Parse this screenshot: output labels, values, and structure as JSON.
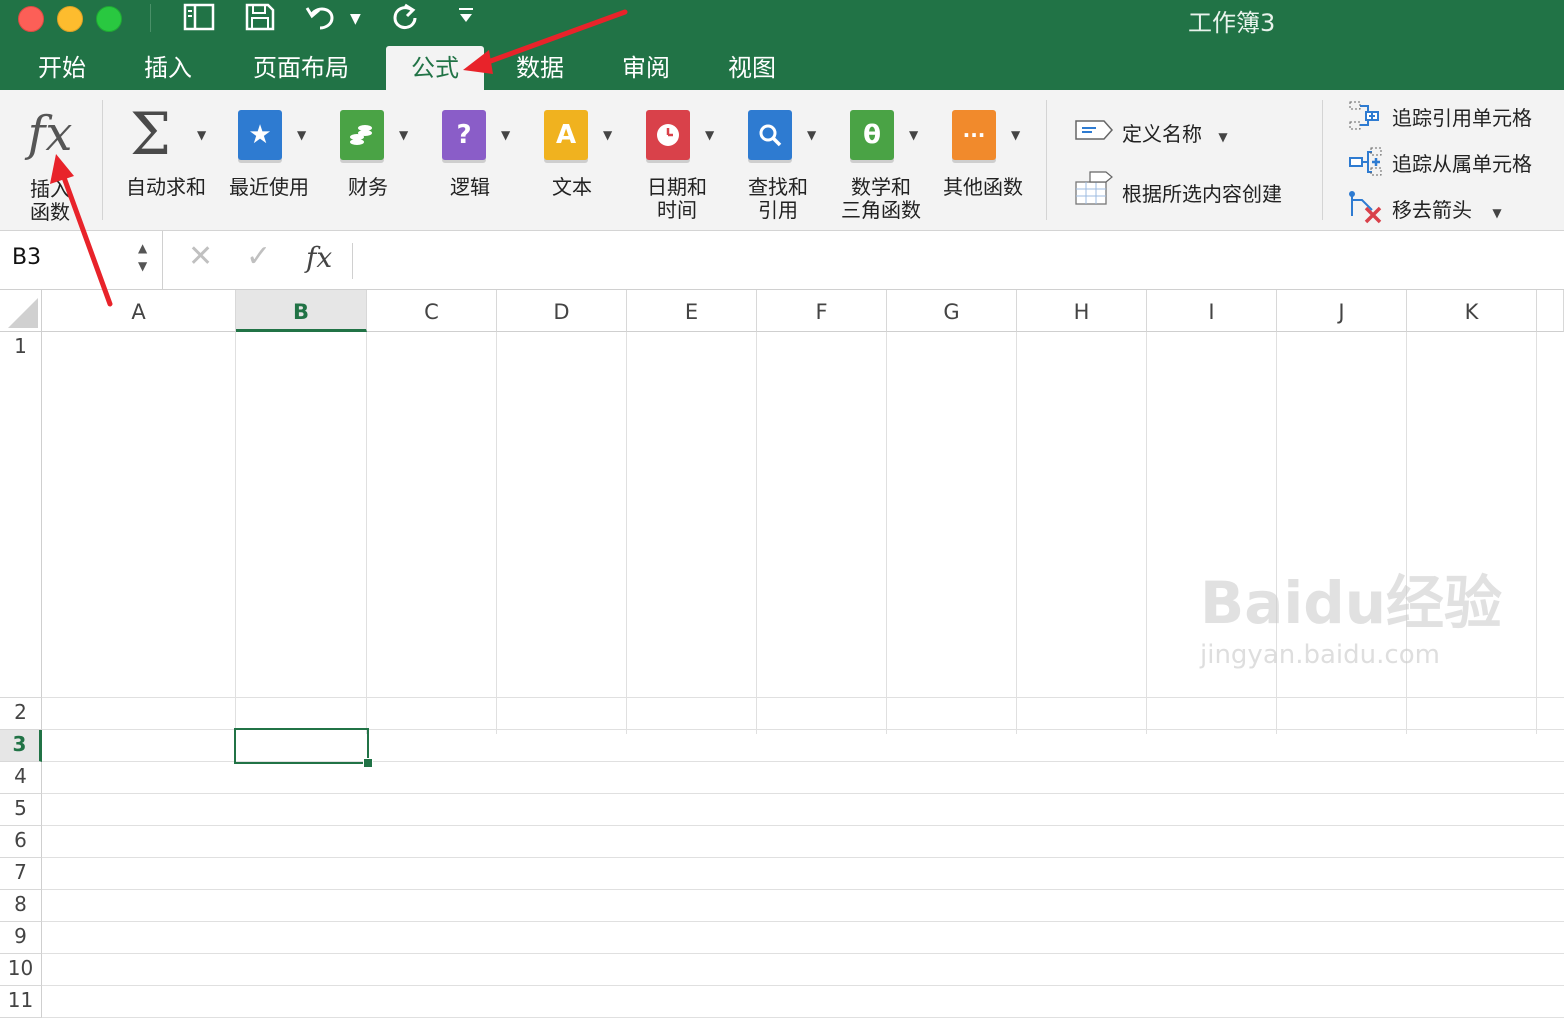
{
  "window": {
    "title": "工作簿3"
  },
  "toolbar_icons": [
    "sidebar-icon",
    "save-icon",
    "undo-icon",
    "redo-icon",
    "customize-icon"
  ],
  "tabs": [
    {
      "label": "开始"
    },
    {
      "label": "插入"
    },
    {
      "label": "页面布局"
    },
    {
      "label": "公式"
    },
    {
      "label": "数据"
    },
    {
      "label": "审阅"
    },
    {
      "label": "视图"
    }
  ],
  "active_tab": "公式",
  "ribbon": {
    "insert_function": {
      "line1": "插入",
      "line2": "函数",
      "icon": "fx"
    },
    "autosum": {
      "label": "自动求和",
      "icon": "Σ"
    },
    "recent": {
      "label": "最近使用",
      "icon": "★"
    },
    "finance": {
      "label": "财务"
    },
    "logic": {
      "label": "逻辑",
      "icon": "?"
    },
    "text": {
      "label": "文本",
      "icon": "A"
    },
    "datetime": {
      "line1": "日期和",
      "line2": "时间"
    },
    "lookup": {
      "line1": "查找和",
      "line2": "引用"
    },
    "math": {
      "line1": "数学和",
      "line2": "三角函数",
      "icon": "θ"
    },
    "other": {
      "label": "其他函数",
      "icon": "···"
    },
    "define_name": "定义名称",
    "create_from_selection": "根据所选内容创建",
    "trace_precedents": "追踪引用单元格",
    "trace_dependents": "追踪从属单元格",
    "remove_arrows": "移去箭头"
  },
  "colors": {
    "brand": "#217346",
    "autosum": "#4a4a4a",
    "recent": "#2e7bd1",
    "finance": "#4aa345",
    "logic": "#8a5dc8",
    "text": "#f0b21f",
    "datetime": "#d9414a",
    "lookup": "#2e7bd1",
    "math": "#4aa345",
    "other": "#f18a2c",
    "annotation_arrow": "#e8232a"
  },
  "formula_bar": {
    "name_box": "B3",
    "fx": "fx",
    "value": ""
  },
  "columns": [
    "A",
    "B",
    "C",
    "D",
    "E",
    "F",
    "G",
    "H",
    "I",
    "J",
    "K"
  ],
  "rows": [
    "1",
    "2",
    "3",
    "4",
    "5",
    "6",
    "7",
    "8",
    "9",
    "10",
    "11"
  ],
  "selected_cell": "B3",
  "watermark": {
    "logo": "Baidu经验",
    "url": "jingyan.baidu.com"
  }
}
